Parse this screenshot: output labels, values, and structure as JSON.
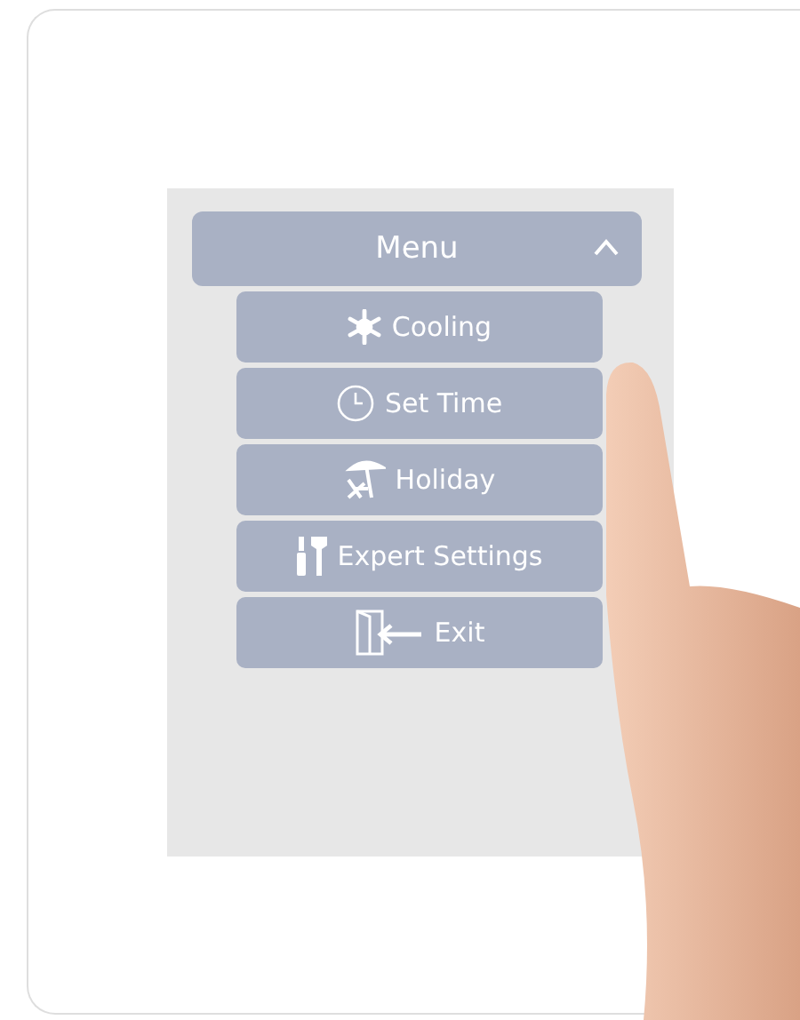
{
  "menu": {
    "title": "Menu",
    "expanded": true,
    "items": [
      {
        "label": "Cooling"
      },
      {
        "label": "Set Time"
      },
      {
        "label": "Holiday"
      },
      {
        "label": "Expert Settings"
      },
      {
        "label": "Exit"
      }
    ]
  }
}
